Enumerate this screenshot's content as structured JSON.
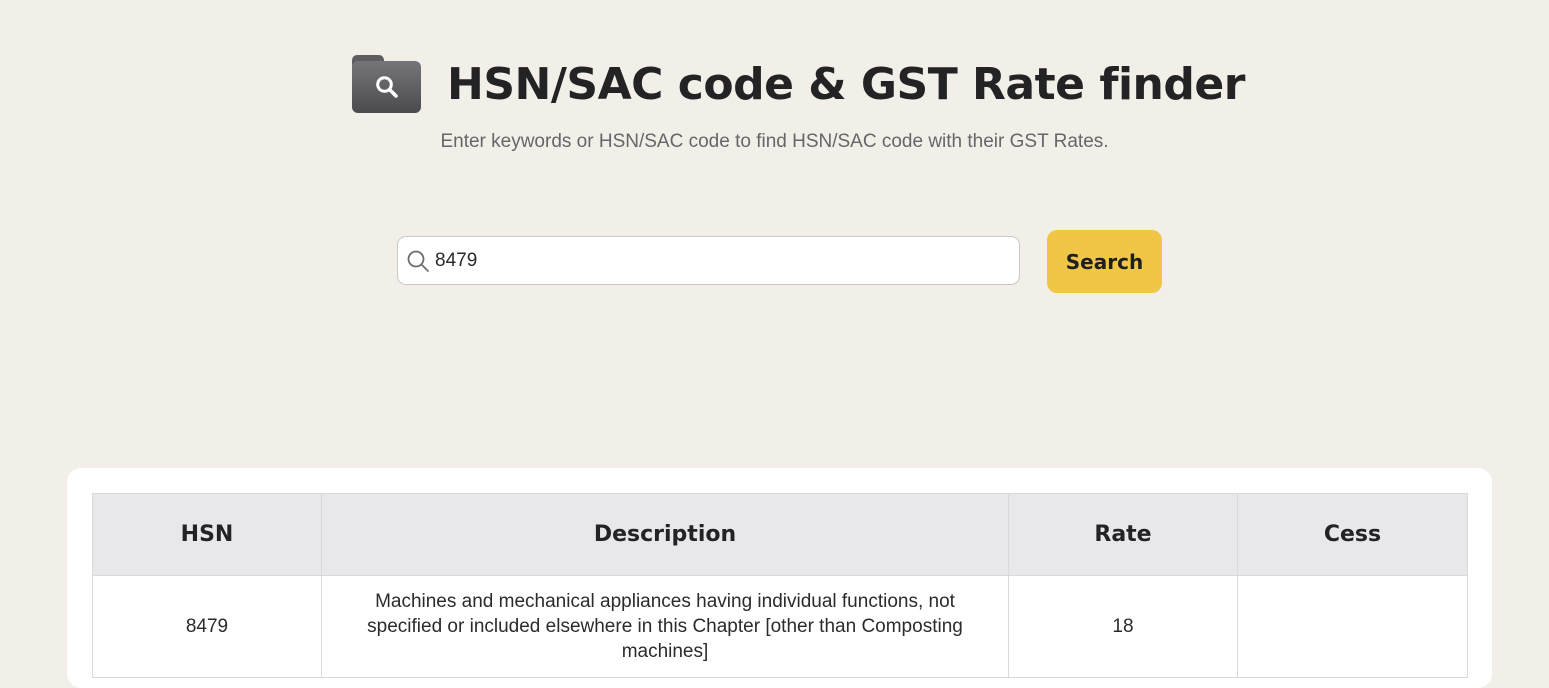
{
  "header": {
    "icon": "folder-search-icon",
    "title": "HSN/SAC code & GST Rate finder",
    "subtitle": "Enter keywords or HSN/SAC code to find HSN/SAC code with their GST Rates."
  },
  "search": {
    "icon": "search-icon",
    "value": "8479",
    "button_label": "Search",
    "button_color": "#efc646"
  },
  "table": {
    "columns": [
      "HSN",
      "Description",
      "Rate",
      "Cess"
    ],
    "rows": [
      {
        "hsn": "8479",
        "description": "Machines and mechanical appliances having individual functions, not specified or included elsewhere in this Chapter [other than Composting machines]",
        "rate": "18",
        "cess": ""
      }
    ]
  }
}
